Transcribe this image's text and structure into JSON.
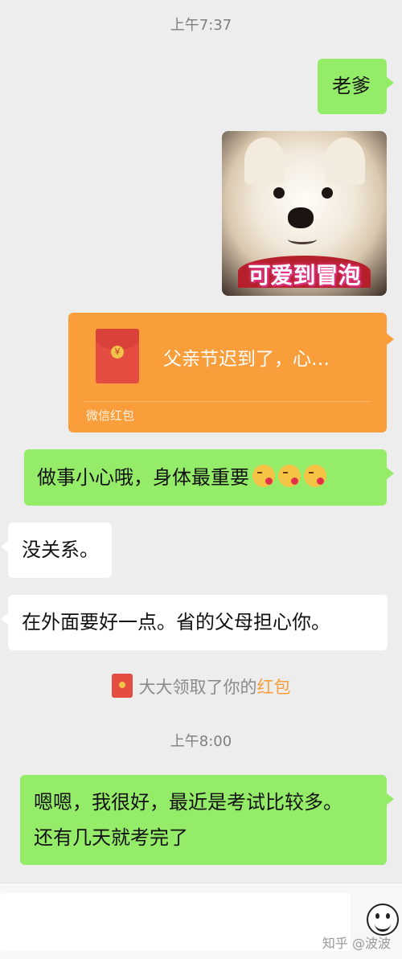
{
  "timestamps": [
    "上午7:37",
    "上午8:00"
  ],
  "messages": [
    {
      "side": "right",
      "text": "老爹"
    },
    {
      "side": "right",
      "type": "image",
      "caption": "可爱到冒泡"
    },
    {
      "side": "right",
      "type": "red_packet",
      "title": "父亲节迟到了，心…",
      "footer": "微信红包"
    },
    {
      "side": "right",
      "text": "做事小心哦，身体最重要",
      "emoji": "kissing-face"
    },
    {
      "side": "left",
      "text": "没关系。"
    },
    {
      "side": "left",
      "text": "在外面要好一点。省的父母担心你。"
    },
    {
      "side": "right",
      "lines": [
        "嗯嗯，我很好，最近是考试比较多。",
        "还有几天就考完了"
      ]
    }
  ],
  "notice": {
    "prefix": "大大领取了你的",
    "highlight": "红包"
  },
  "watermark": "知乎 @波波",
  "colors": {
    "background": "#ededed",
    "bubble_right": "#95ec69",
    "bubble_left": "#ffffff",
    "red_packet": "#fa9d3b"
  },
  "icons": {
    "emoji_button": "smiley-icon",
    "red_packet": "red-envelope-icon"
  }
}
